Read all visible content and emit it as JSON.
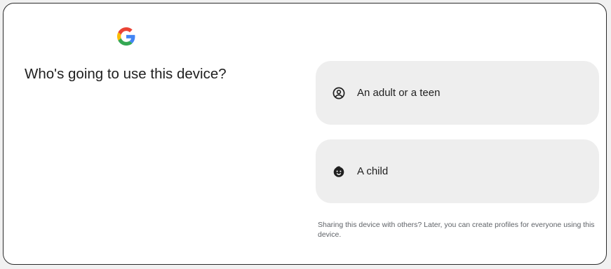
{
  "brand": {
    "logo_icon": "google-g-logo",
    "colors": {
      "blue": "#4285F4",
      "red": "#EA4335",
      "yellow": "#FBBC05",
      "green": "#34A853"
    }
  },
  "page": {
    "title": "Who's going to use this device?"
  },
  "options": [
    {
      "icon": "account-circle-icon",
      "label": "An adult or a teen"
    },
    {
      "icon": "child-face-icon",
      "label": "A child"
    }
  ],
  "footnote": "Sharing this device with others? Later, you can create profiles for everyone using this device.",
  "colors": {
    "card_background": "#eeeeee",
    "text_primary": "#1f1f1f",
    "text_secondary": "#5f6368"
  }
}
